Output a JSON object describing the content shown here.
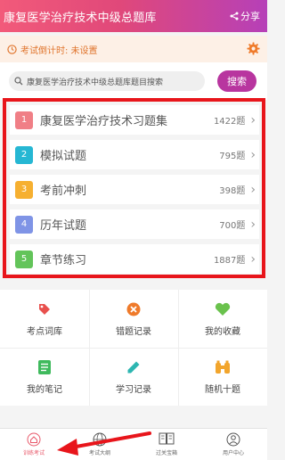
{
  "header": {
    "title": "康复医学治疗技术中级总题库",
    "share_label": "分享",
    "brand_gradient": [
      "#f25a7a",
      "#b640b8"
    ]
  },
  "countdown": {
    "text": "考试倒计时: 未设置",
    "icon": "clock-icon",
    "settings_icon": "gear-icon",
    "color": "#e0742c"
  },
  "search": {
    "placeholder": "康复医学治疗技术中级总题库题目搜索",
    "button_label": "搜索",
    "button_color": "#b8359f"
  },
  "question_banks": [
    {
      "num": "1",
      "label": "康复医学治疗技术习题集",
      "count": "1422题",
      "color": "#f07f86"
    },
    {
      "num": "2",
      "label": "模拟试题",
      "count": "795题",
      "color": "#26b7d3"
    },
    {
      "num": "3",
      "label": "考前冲刺",
      "count": "398题",
      "color": "#f6b031"
    },
    {
      "num": "4",
      "label": "历年试题",
      "count": "700题",
      "color": "#7f94e6"
    },
    {
      "num": "5",
      "label": "章节练习",
      "count": "1887题",
      "color": "#63c45a"
    }
  ],
  "grid": [
    {
      "label": "考点词库",
      "icon": "tag-icon",
      "color": "#e8504d"
    },
    {
      "label": "错题记录",
      "icon": "close-circle-icon",
      "color": "#ef7a2a"
    },
    {
      "label": "我的收藏",
      "icon": "heart-icon",
      "color": "#6ac24d"
    },
    {
      "label": "我的笔记",
      "icon": "notes-icon",
      "color": "#3fba5d"
    },
    {
      "label": "学习记录",
      "icon": "pencil-icon",
      "color": "#2db6b1"
    },
    {
      "label": "随机十题",
      "icon": "binoculars-icon",
      "color": "#f2a52c"
    }
  ],
  "tabbar": [
    {
      "label": "训练考试",
      "icon": "home-icon",
      "active": true
    },
    {
      "label": "考试大纲",
      "icon": "globe-icon",
      "active": false
    },
    {
      "label": "过关宝箱",
      "icon": "book-icon",
      "active": false
    },
    {
      "label": "用户中心",
      "icon": "user-icon",
      "active": false
    }
  ],
  "highlight_color": "#e8151b"
}
